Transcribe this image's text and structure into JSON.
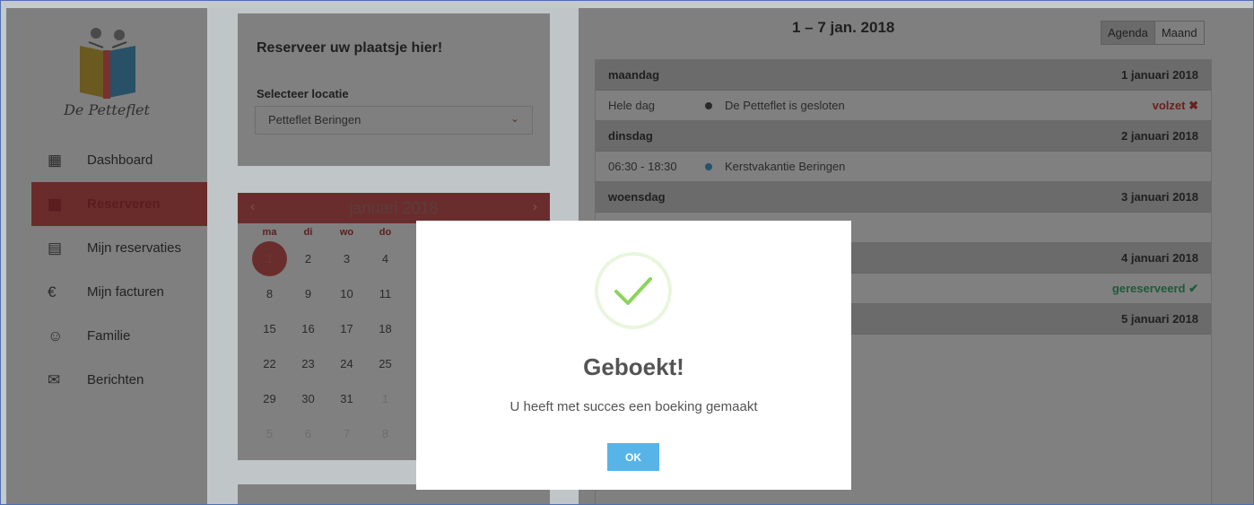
{
  "brand": {
    "name": "De Petteflet"
  },
  "sidebar": {
    "items": [
      {
        "label": "Dashboard",
        "icon": "dashboard-icon",
        "active": false
      },
      {
        "label": "Reserveren",
        "icon": "calendar-icon",
        "active": true
      },
      {
        "label": "Mijn reservaties",
        "icon": "document-icon",
        "active": false
      },
      {
        "label": "Mijn facturen",
        "icon": "euro-icon",
        "active": false
      },
      {
        "label": "Familie",
        "icon": "family-icon",
        "active": false
      },
      {
        "label": "Berichten",
        "icon": "envelope-icon",
        "active": false
      }
    ]
  },
  "booking": {
    "title": "Reserveer uw plaatsje hier!",
    "location_label": "Selecteer locatie",
    "location_value": "Petteflet Beringen"
  },
  "calendar": {
    "month": "januari",
    "year": "2018",
    "weekdays": [
      "ma",
      "di",
      "wo",
      "do"
    ],
    "rows": [
      [
        "1",
        "2",
        "3",
        "4"
      ],
      [
        "8",
        "9",
        "10",
        "11"
      ],
      [
        "15",
        "16",
        "17",
        "18"
      ],
      [
        "22",
        "23",
        "24",
        "25"
      ],
      [
        "29",
        "30",
        "31",
        "1"
      ],
      [
        "5",
        "6",
        "7",
        "8"
      ]
    ],
    "selected_day": "1"
  },
  "agenda": {
    "range_title": "1 – 7 jan. 2018",
    "view_agenda": "Agenda",
    "view_month": "Maand",
    "days": [
      {
        "name": "maandag",
        "date": "1 januari 2018",
        "time": "Hele dag",
        "event": "De Petteflet is gesloten",
        "status": "volzet ✖"
      },
      {
        "name": "dinsdag",
        "date": "2 januari 2018",
        "time": "06:30 - 18:30",
        "event": "Kerstvakantie Beringen",
        "status": ""
      },
      {
        "name": "woensdag",
        "date": "3 januari 2018"
      },
      {
        "date": "4 januari 2018",
        "status": "gereserveerd ✔"
      },
      {
        "date": "5 januari 2018"
      }
    ]
  },
  "modal": {
    "title": "Geboekt!",
    "message": "U heeft met succes een boeking gemaakt",
    "ok_label": "OK"
  },
  "colors": {
    "accent": "#d9534f",
    "success": "#3fb27f",
    "ok_button": "#56b4e9",
    "check": "#8cd45a"
  }
}
